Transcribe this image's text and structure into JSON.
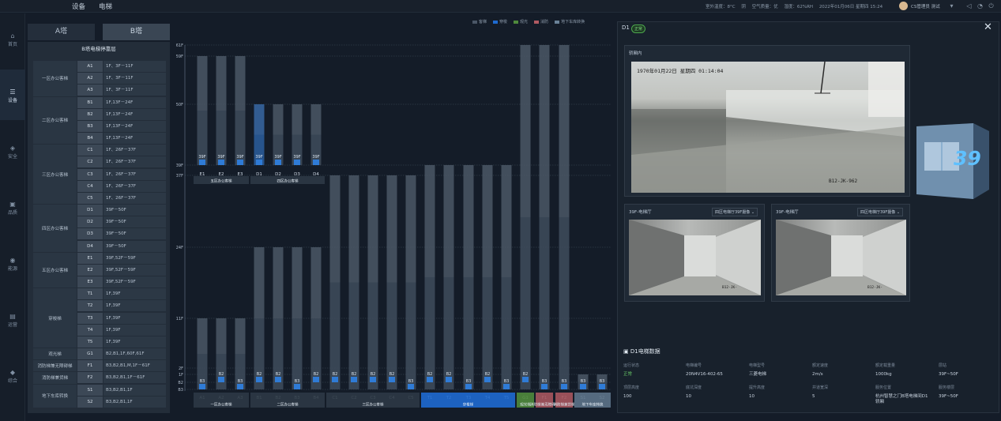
{
  "nav": {
    "device": "设备",
    "elevator": "电梯"
  },
  "topbar": {
    "outdoor_temp": "室外温度：8°C",
    "weather": "阴",
    "air_quality": "空气质量：优",
    "humidity": "湿度：62%RH",
    "datetime": "2022年01月06日 星期四 15:24",
    "user": "CS管理员 测试"
  },
  "sidebar": [
    {
      "label": "首页",
      "icon": "home-icon"
    },
    {
      "label": "设备",
      "icon": "device-icon"
    },
    {
      "label": "安全",
      "icon": "shield-icon"
    },
    {
      "label": "品质",
      "icon": "quality-icon"
    },
    {
      "label": "能源",
      "icon": "energy-icon"
    },
    {
      "label": "运营",
      "icon": "operation-icon"
    },
    {
      "label": "综合",
      "icon": "dashboard-icon"
    }
  ],
  "tower_tabs": {
    "a": "A塔",
    "b": "B塔"
  },
  "floor_table": {
    "title": "B塔电梯停靠层",
    "groups": [
      {
        "name": "一区办公客梯",
        "rows": [
          [
            "A1",
            "1F、3F－11F"
          ],
          [
            "A2",
            "1F、3F－11F"
          ],
          [
            "A3",
            "1F、3F－11F"
          ]
        ]
      },
      {
        "name": "二区办公客梯",
        "rows": [
          [
            "B1",
            "1F,13F－24F"
          ],
          [
            "B2",
            "1F,13F－24F"
          ],
          [
            "B3",
            "1F,13F－24F"
          ],
          [
            "B4",
            "1F,13F－24F"
          ]
        ]
      },
      {
        "name": "三区办公客梯",
        "rows": [
          [
            "C1",
            "1F、26F－37F"
          ],
          [
            "C2",
            "1F、26F－37F"
          ],
          [
            "C3",
            "1F、26F－37F"
          ],
          [
            "C4",
            "1F、26F－37F"
          ],
          [
            "C5",
            "1F、26F－37F"
          ]
        ]
      },
      {
        "name": "四区办公客梯",
        "rows": [
          [
            "D1",
            "39F－50F"
          ],
          [
            "D2",
            "39F－50F"
          ],
          [
            "D3",
            "39F－50F"
          ],
          [
            "D4",
            "39F－50F"
          ]
        ]
      },
      {
        "name": "五区办公客梯",
        "rows": [
          [
            "E1",
            "39F,52F－59F"
          ],
          [
            "E2",
            "39F,52F－59F"
          ],
          [
            "E3",
            "39F,52F－59F"
          ]
        ]
      },
      {
        "name": "穿梭梯",
        "rows": [
          [
            "T1",
            "1F,39F"
          ],
          [
            "T2",
            "1F,39F"
          ],
          [
            "T3",
            "1F,39F"
          ],
          [
            "T4",
            "1F,39F"
          ],
          [
            "T5",
            "1F,39F"
          ]
        ]
      },
      {
        "name": "观光梯",
        "rows": [
          [
            "G1",
            "B2,B1,1F,60F,61F"
          ]
        ]
      },
      {
        "name": "消防梯兼无障碍梯",
        "rows": [
          [
            "F1",
            "B3,B2,B1,M,1F－61F"
          ]
        ]
      },
      {
        "name": "消防梯兼货梯",
        "rows": [
          [
            "F2",
            "B3,B2,B1,1F－61F"
          ]
        ]
      },
      {
        "name": "地下车库转换",
        "rows": [
          [
            "S1",
            "B3,B2,B1,1F"
          ],
          [
            "S2",
            "B3,B2,B1,1F"
          ]
        ]
      }
    ]
  },
  "legend": [
    {
      "label": "客梯",
      "color": "#4a5666"
    },
    {
      "label": "穿梭",
      "color": "#1e6ad0"
    },
    {
      "label": "观光",
      "color": "#4f8a3c"
    },
    {
      "label": "消防",
      "color": "#b05a62"
    },
    {
      "label": "地下车库转换",
      "color": "#6a8298"
    }
  ],
  "chart_data": {
    "type": "bar",
    "floor_axis_ticks": [
      "61F",
      "59F",
      "50F",
      "39F",
      "37F",
      "24F",
      "11F",
      "2F",
      "1F",
      "B2",
      "B3"
    ],
    "elevators": [
      {
        "id": "E1",
        "low": "39F",
        "high": "59F",
        "car": "39F"
      },
      {
        "id": "E2",
        "low": "39F",
        "high": "59F",
        "car": "39F"
      },
      {
        "id": "E3",
        "low": "39F",
        "high": "59F",
        "car": "39F"
      },
      {
        "id": "D1",
        "low": "39F",
        "high": "50F",
        "car": "39F"
      },
      {
        "id": "D2",
        "low": "39F",
        "high": "50F",
        "car": "39F"
      },
      {
        "id": "D3",
        "low": "39F",
        "high": "50F",
        "car": "39F"
      },
      {
        "id": "D4",
        "low": "39F",
        "high": "50F",
        "car": "39F"
      },
      {
        "id": "A1",
        "low": "B3",
        "high": "11F",
        "car": "B3"
      },
      {
        "id": "A2",
        "low": "B3",
        "high": "11F",
        "car": "B2"
      },
      {
        "id": "A3",
        "low": "B3",
        "high": "11F",
        "car": "B3"
      },
      {
        "id": "B1",
        "low": "B3",
        "high": "24F",
        "car": "B2"
      },
      {
        "id": "B2",
        "low": "B3",
        "high": "24F",
        "car": "B2"
      },
      {
        "id": "B3",
        "low": "B3",
        "high": "24F",
        "car": "B3"
      },
      {
        "id": "B4",
        "low": "B3",
        "high": "24F",
        "car": "B2"
      },
      {
        "id": "C1",
        "low": "B3",
        "high": "37F",
        "car": "B2"
      },
      {
        "id": "C2",
        "low": "B3",
        "high": "37F",
        "car": "B2"
      },
      {
        "id": "C3",
        "low": "B3",
        "high": "37F",
        "car": "B2"
      },
      {
        "id": "C4",
        "low": "B3",
        "high": "37F",
        "car": "B2"
      },
      {
        "id": "C5",
        "low": "B3",
        "high": "37F",
        "car": "B3"
      },
      {
        "id": "T1",
        "low": "B3",
        "high": "39F",
        "car": "B2"
      },
      {
        "id": "T2",
        "low": "B3",
        "high": "39F",
        "car": "B2"
      },
      {
        "id": "T3",
        "low": "B3",
        "high": "39F",
        "car": "B3"
      },
      {
        "id": "T4",
        "low": "B3",
        "high": "39F",
        "car": "B2"
      },
      {
        "id": "T5",
        "low": "B3",
        "high": "39F",
        "car": "B3"
      },
      {
        "id": "G1",
        "low": "B3",
        "high": "61F",
        "car": "B2"
      },
      {
        "id": "F1",
        "low": "B3",
        "high": "61F",
        "car": "B3"
      },
      {
        "id": "F2",
        "low": "B3",
        "high": "61F",
        "car": "B3"
      },
      {
        "id": "S1",
        "low": "B3",
        "high": "1F",
        "car": "B3"
      },
      {
        "id": "S2",
        "low": "B3",
        "high": "1F",
        "car": "B3"
      }
    ],
    "group_labels": [
      {
        "label": "五区办公客梯",
        "members": [
          "E1",
          "E2",
          "E3"
        ]
      },
      {
        "label": "四区办公客梯",
        "members": [
          "D1",
          "D2",
          "D3",
          "D4"
        ]
      },
      {
        "label": "一区办公客梯",
        "members": [
          "A1",
          "A2",
          "A3"
        ]
      },
      {
        "label": "二区办公客梯",
        "members": [
          "B1",
          "B2",
          "B3",
          "B4"
        ]
      },
      {
        "label": "三区办公客梯",
        "members": [
          "C1",
          "C2",
          "C3",
          "C4",
          "C5"
        ]
      },
      {
        "label": "穿梭梯",
        "members": [
          "T1",
          "T2",
          "T3",
          "T4",
          "T5"
        ]
      },
      {
        "label": "观光梯",
        "members": [
          "G1"
        ]
      },
      {
        "label": "消防梯兼无障碍梯",
        "members": [
          "F1"
        ]
      },
      {
        "label": "消防梯兼货梯",
        "members": [
          "F2"
        ]
      },
      {
        "label": "地下车库转换",
        "members": [
          "S1",
          "S2"
        ]
      }
    ]
  },
  "detail_panel": {
    "title": "D1",
    "status_badge": "正常",
    "main_camera": {
      "title": "轿厢内",
      "timestamp": "1970年01月22日  星期四  01:14:04",
      "camera_id": "B12-JK-962"
    },
    "hall_cameras": [
      {
        "title": "39F-电梯厅",
        "selector": "四区电梯厅39F摄像 ⌄",
        "camera_id": "B12-JK-"
      },
      {
        "title": "39F-电梯厅",
        "selector": "四区电梯厅39F摄像 ⌄",
        "camera_id": "B12-JK-"
      }
    ],
    "car_floor": "39",
    "data_title": "D1电梯数据",
    "data": [
      {
        "label": "运行状态",
        "value": "正常",
        "value_color": "#66c466"
      },
      {
        "label": "电梯编号",
        "value": "20N4V16-402-65"
      },
      {
        "label": "电梯型号",
        "value": "三菱电梯"
      },
      {
        "label": "额定速度",
        "value": "2m/s"
      },
      {
        "label": "额定载重量",
        "value": "1000kg"
      },
      {
        "label": "层站",
        "value": "39F~50F"
      },
      {
        "label": "顶层高度",
        "value": "100"
      },
      {
        "label": "底坑深度",
        "value": "10"
      },
      {
        "label": "提升高度",
        "value": "10"
      },
      {
        "label": "井道宽深",
        "value": "5"
      },
      {
        "label": "服务位置",
        "value": "杭州智慧之门B塔电梯间D1轿厢"
      },
      {
        "label": "服务楼层",
        "value": "39F~50F"
      }
    ]
  }
}
